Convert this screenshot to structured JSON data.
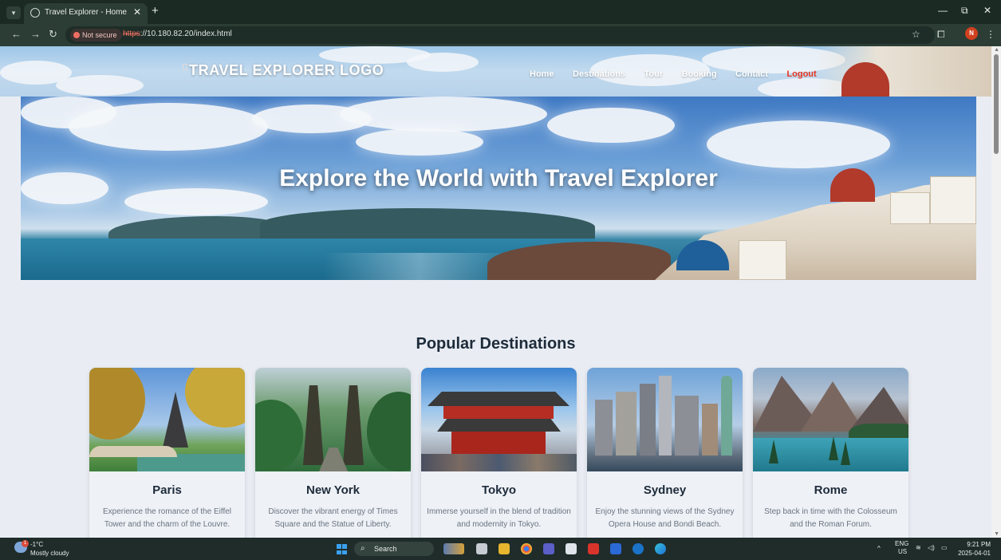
{
  "browser": {
    "tab_title": "Travel Explorer - Home",
    "security_label": "Not secure",
    "url_scheme": "https",
    "url_rest": "://10.180.82.20/index.html"
  },
  "header": {
    "logo_alt": "TRAVEL EXPLORER LOGO",
    "nav": [
      "Home",
      "Destinations",
      "Tour",
      "Booking",
      "Contact",
      "Logout"
    ]
  },
  "hero": {
    "title": "Explore the World with Travel Explorer"
  },
  "destinations": {
    "heading": "Popular Destinations",
    "cards": [
      {
        "name": "Paris",
        "description": "Experience the romance of the Eiffel Tower and the charm of the Louvre."
      },
      {
        "name": "New York",
        "description": "Discover the vibrant energy of Times Square and the Statue of Liberty."
      },
      {
        "name": "Tokyo",
        "description": "Immerse yourself in the blend of tradition and modernity in Tokyo."
      },
      {
        "name": "Sydney",
        "description": "Enjoy the stunning views of the Sydney Opera House and Bondi Beach."
      },
      {
        "name": "Rome",
        "description": "Step back in time with the Colosseum and the Roman Forum."
      }
    ]
  },
  "taskbar": {
    "temperature": "-1°C",
    "weather": "Mostly cloudy",
    "weather_badge": "1",
    "search_label": "Search",
    "lang_top": "ENG",
    "lang_bottom": "US",
    "time": "9:21 PM",
    "date": "2025-04-01"
  },
  "profile_initial": "N",
  "colors": {
    "logout": "#e8351f",
    "chrome_bg": "#1b2b24",
    "taskbar_bg": "#1f2c2a",
    "heading": "#1d2b3a"
  }
}
